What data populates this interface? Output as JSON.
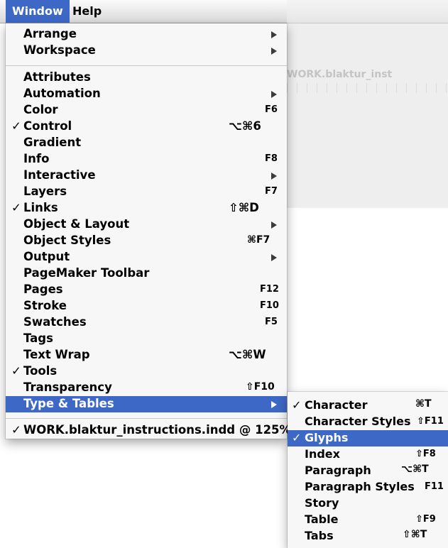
{
  "menubar": {
    "items": [
      {
        "label": "Window",
        "active": true
      },
      {
        "label": "Help",
        "active": false
      }
    ]
  },
  "background": {
    "document_title": "WORK.blaktur_inst"
  },
  "window_menu": {
    "items": [
      {
        "label": "Arrange",
        "submenu": true
      },
      {
        "label": "Workspace",
        "submenu": true
      },
      {
        "separator": true
      },
      {
        "label": "Attributes"
      },
      {
        "label": "Automation",
        "submenu": true
      },
      {
        "label": "Color",
        "shortcut": "F6"
      },
      {
        "label": "Control",
        "checked": true,
        "shortcut": "⌥⌘6"
      },
      {
        "label": "Gradient"
      },
      {
        "label": "Info",
        "shortcut": "F8"
      },
      {
        "label": "Interactive",
        "submenu": true
      },
      {
        "label": "Layers",
        "shortcut": "F7"
      },
      {
        "label": "Links",
        "checked": true,
        "shortcut": "⇧⌘D"
      },
      {
        "label": "Object & Layout",
        "submenu": true
      },
      {
        "label": "Object Styles",
        "shortcut": "⌘F7"
      },
      {
        "label": "Output",
        "submenu": true
      },
      {
        "label": "PageMaker Toolbar"
      },
      {
        "label": "Pages",
        "shortcut": "F12"
      },
      {
        "label": "Stroke",
        "shortcut": "F10"
      },
      {
        "label": "Swatches",
        "shortcut": "F5"
      },
      {
        "label": "Tags"
      },
      {
        "label": "Text Wrap",
        "shortcut": "⌥⌘W"
      },
      {
        "label": "Tools",
        "checked": true
      },
      {
        "label": "Transparency",
        "shortcut": "⇧F10"
      },
      {
        "label": "Type & Tables",
        "submenu": true,
        "highlighted": true
      },
      {
        "separator": true
      },
      {
        "label": "WORK.blaktur_instructions.indd @ 125%",
        "checked": true
      }
    ]
  },
  "type_tables_submenu": {
    "items": [
      {
        "label": "Character",
        "checked": true,
        "shortcut": "⌘T"
      },
      {
        "label": "Character Styles",
        "shortcut": "⇧F11"
      },
      {
        "label": "Glyphs",
        "checked": true,
        "highlighted": true
      },
      {
        "label": "Index",
        "shortcut": "⇧F8"
      },
      {
        "label": "Paragraph",
        "shortcut": "⌥⌘T"
      },
      {
        "label": "Paragraph Styles",
        "shortcut": "F11"
      },
      {
        "label": "Story"
      },
      {
        "label": "Table",
        "shortcut": "⇧F9"
      },
      {
        "label": "Tabs",
        "shortcut": "⇧⌘T"
      }
    ]
  },
  "colors": {
    "highlight": "#3e68c5",
    "menu_bg": "#f7f7f7",
    "separator": "#c9c9c9"
  }
}
